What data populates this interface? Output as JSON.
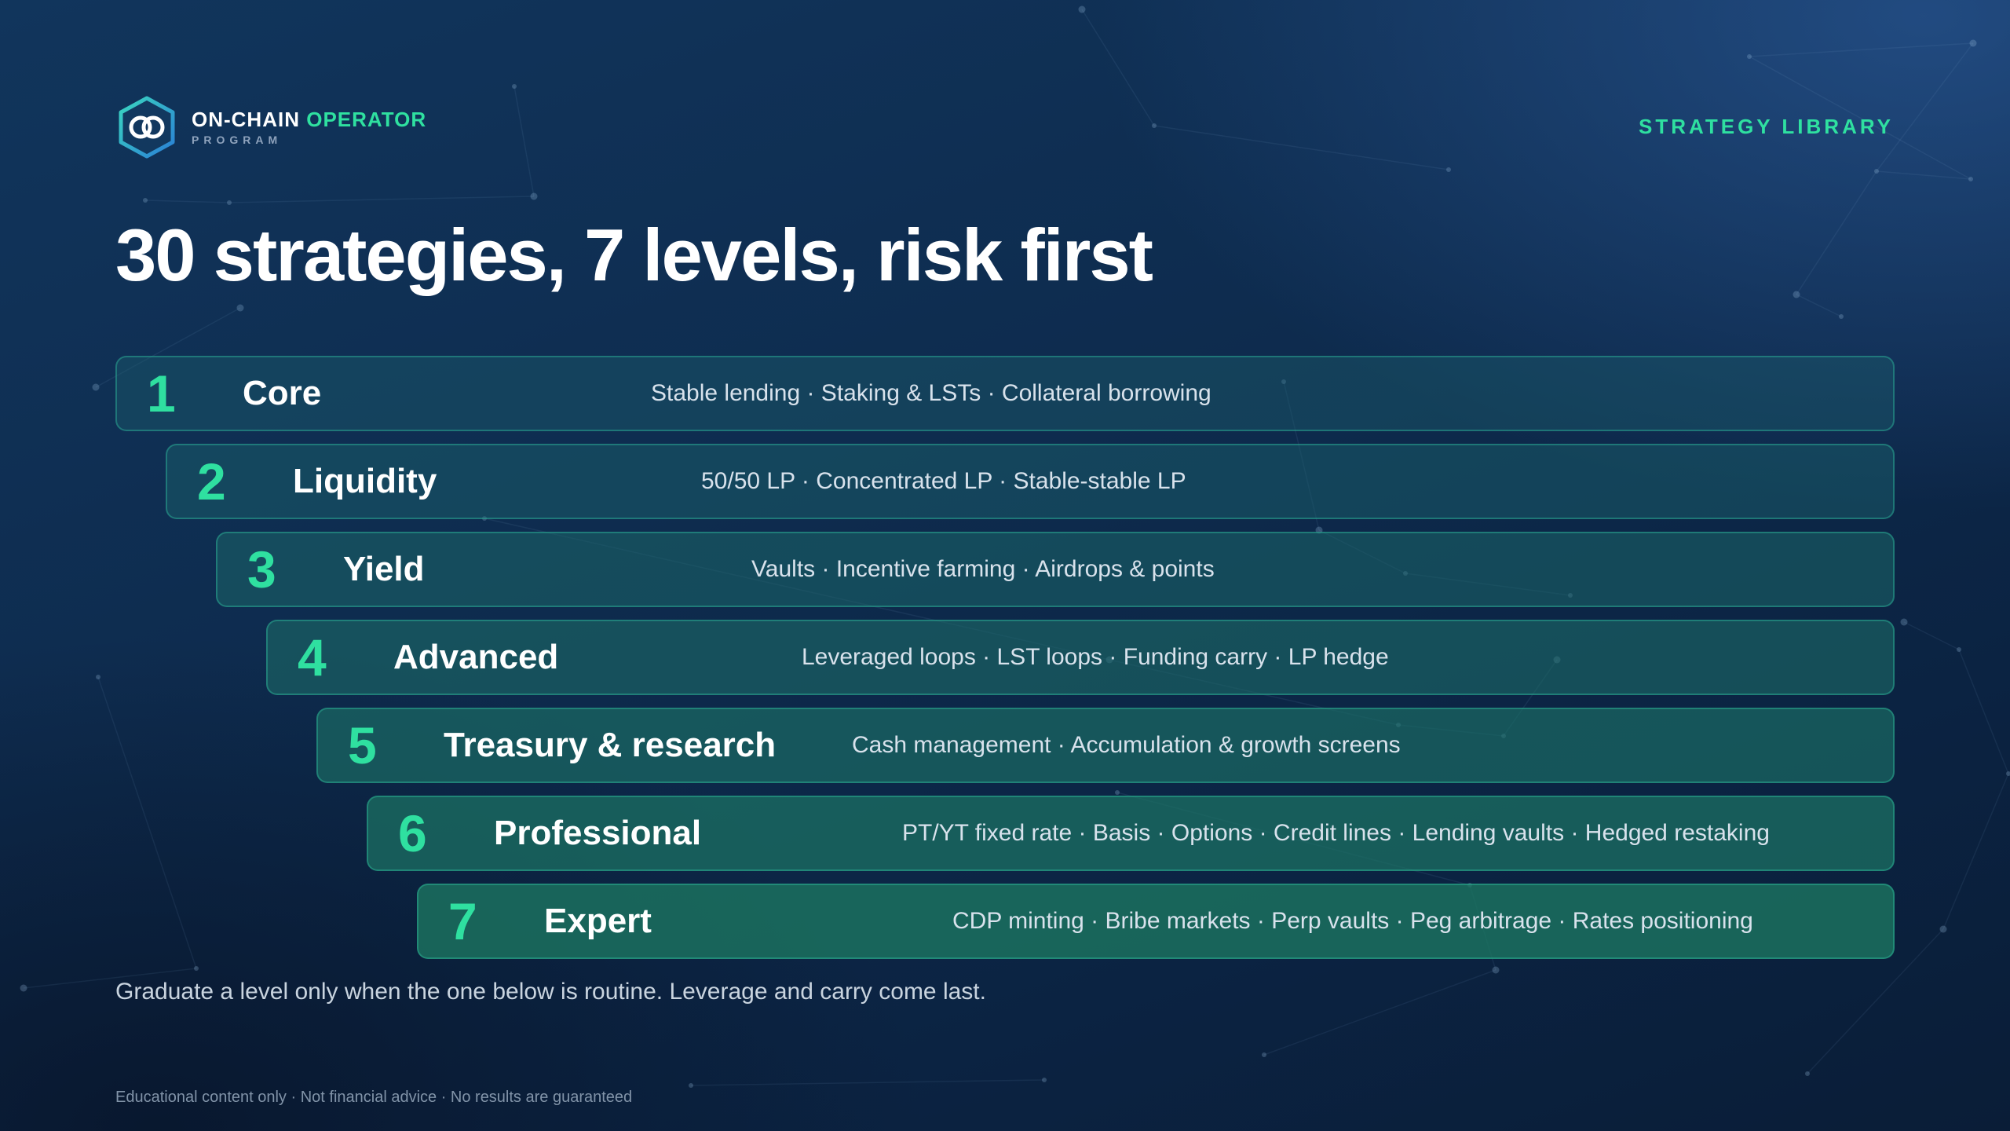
{
  "brand": {
    "name_part1": "ON-CHAIN",
    "name_part2": "OPERATOR",
    "subtitle": "PROGRAM",
    "logo_icon": "hexagon-infinity-icon"
  },
  "section_label": "STRATEGY LIBRARY",
  "title": "30 strategies, 7 levels, risk first",
  "levels": [
    {
      "number": "1",
      "name": "Core",
      "description": "Stable lending · Staking & LSTs · Collateral borrowing"
    },
    {
      "number": "2",
      "name": "Liquidity",
      "description": "50/50 LP · Concentrated LP · Stable-stable LP"
    },
    {
      "number": "3",
      "name": "Yield",
      "description": "Vaults · Incentive farming · Airdrops & points"
    },
    {
      "number": "4",
      "name": "Advanced",
      "description": "Leveraged loops · LST loops · Funding carry · LP hedge"
    },
    {
      "number": "5",
      "name": "Treasury & research",
      "description": "Cash management · Accumulation & growth screens"
    },
    {
      "number": "6",
      "name": "Professional",
      "description": "PT/YT fixed rate · Basis · Options · Credit lines · Lending vaults · Hedged restaking"
    },
    {
      "number": "7",
      "name": "Expert",
      "description": "CDP minting · Bribe markets · Perp vaults · Peg arbitrage · Rates positioning"
    }
  ],
  "footnote": "Graduate a level only when the one below is routine. Leverage and carry come last.",
  "disclaimer": "Educational content only · Not financial advice · No results are guaranteed",
  "colors": {
    "accent": "#2fe0a0",
    "background": "#0e2c4f",
    "level_border": "#30bea0"
  }
}
